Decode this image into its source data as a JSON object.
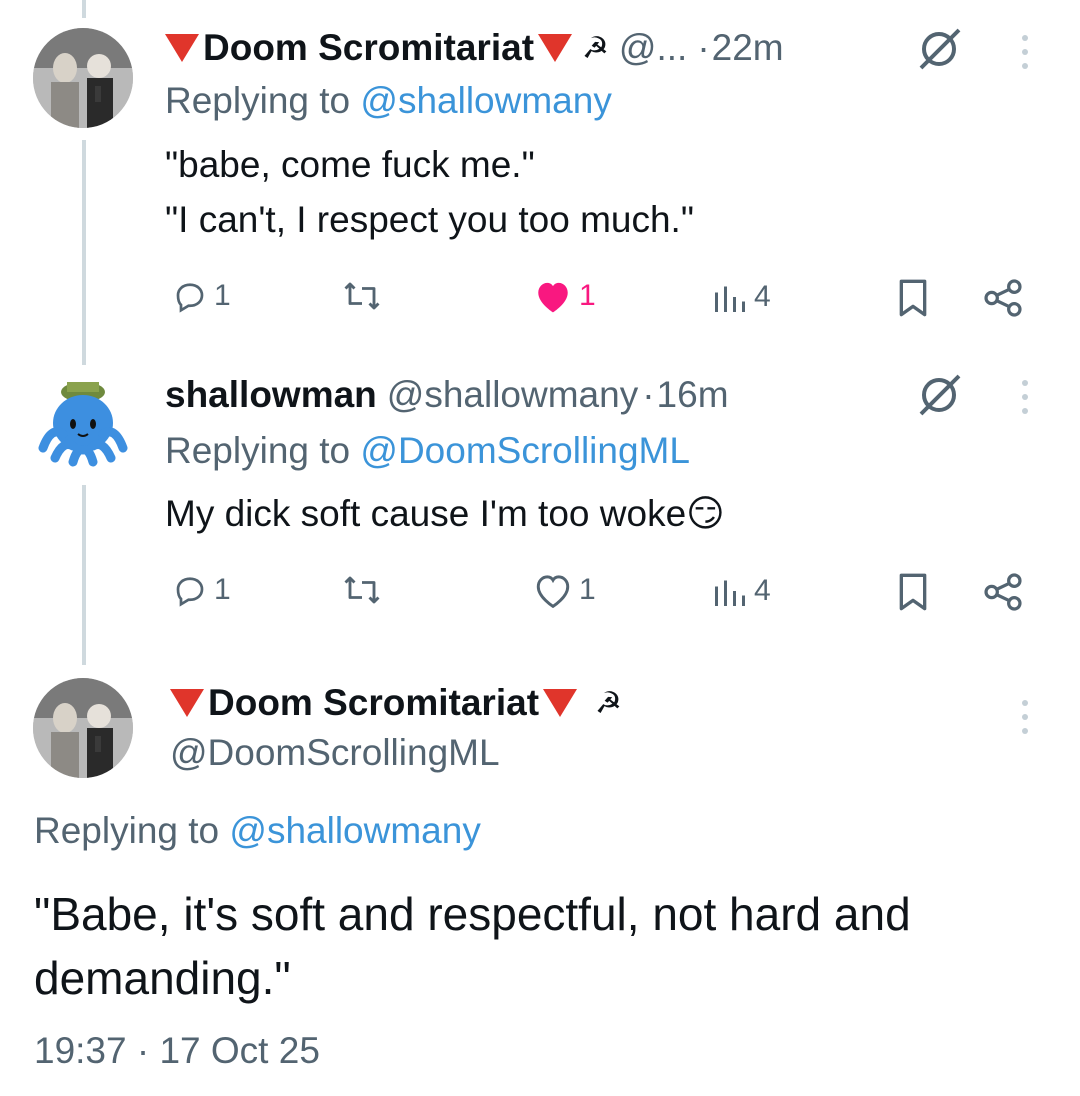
{
  "tweets": [
    {
      "display_name": "Doom Scromitariat",
      "handle_truncated": "@...",
      "dot": "·",
      "time": "22m",
      "emblem": "☭",
      "replying_prefix": "Replying to",
      "replying_to": "@shallowmany",
      "text_line1": "\"babe, come fuck me.\"",
      "text_line2": "\"I can't, I respect you too much.\"",
      "replies": "1",
      "likes": "1",
      "liked": true,
      "views": "4"
    },
    {
      "display_name": "shallowman",
      "handle": "@shallowmany",
      "dot": "·",
      "time": "16m",
      "replying_prefix": "Replying to",
      "replying_to": "@DoomScrollingML",
      "text": "My dick soft cause I'm too woke",
      "emoji": "😏",
      "replies": "1",
      "likes": "1",
      "liked": false,
      "views": "4"
    },
    {
      "display_name": "Doom Scromitariat",
      "emblem": "☭",
      "handle": "@DoomScrollingML",
      "replying_prefix": "Replying to",
      "replying_to": "@shallowmany",
      "text_line1": "\"Babe, it's soft and respectful, not hard and",
      "text_line2": "demanding.\"",
      "timestamp": "19:37 · 17 Oct 25"
    }
  ],
  "colors": {
    "like_active": "#f91880",
    "link": "#3b94d9",
    "muted": "#536471",
    "flag_red": "#e0352b"
  },
  "icons": [
    "reply-icon",
    "retweet-icon",
    "heart-icon",
    "views-icon",
    "bookmark-icon",
    "share-icon",
    "grok-icon",
    "more-icon"
  ]
}
